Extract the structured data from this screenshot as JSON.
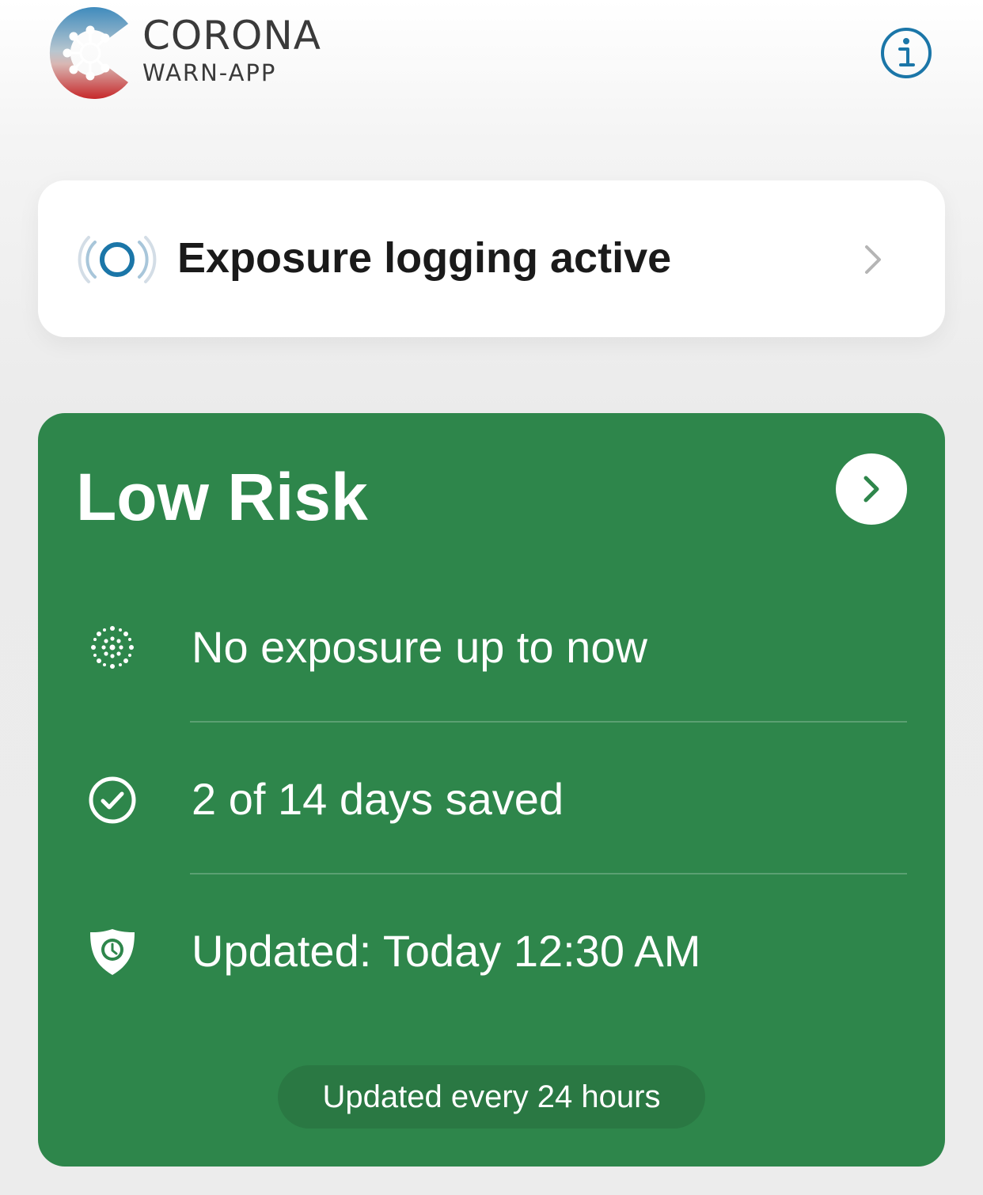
{
  "header": {
    "brand_title": "CORONA",
    "brand_subtitle": "WARN-APP",
    "info_icon": "info-icon"
  },
  "exposure_card": {
    "label": "Exposure logging active",
    "icon": "exposure-signal-icon",
    "chevron_icon": "chevron-right-icon",
    "accent_color": "#1b76a8"
  },
  "risk_card": {
    "title": "Low Risk",
    "background_color": "#2e864b",
    "arrow_icon": "chevron-right-icon",
    "rows": [
      {
        "icon": "virus-dots-icon",
        "text": "No exposure up to now"
      },
      {
        "icon": "check-circle-icon",
        "text": "2 of 14 days saved"
      },
      {
        "icon": "shield-clock-icon",
        "text": "Updated: Today 12:30 AM"
      }
    ],
    "update_note": "Updated every 24 hours"
  }
}
